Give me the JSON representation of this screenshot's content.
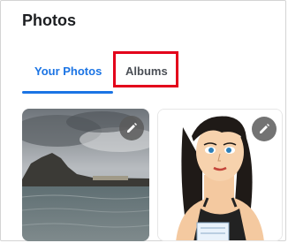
{
  "header": {
    "title": "Photos"
  },
  "tabs": [
    {
      "label": "Your Photos",
      "active": true
    },
    {
      "label": "Albums",
      "active": false
    }
  ],
  "photos": [
    {
      "kind": "photo",
      "subject": "landscape",
      "edit_icon": "pencil-icon"
    },
    {
      "kind": "photo",
      "subject": "cartoon-woman",
      "edit_icon": "pencil-icon"
    }
  ],
  "colors": {
    "accent": "#1b74e4",
    "highlight": "#e3001b"
  }
}
